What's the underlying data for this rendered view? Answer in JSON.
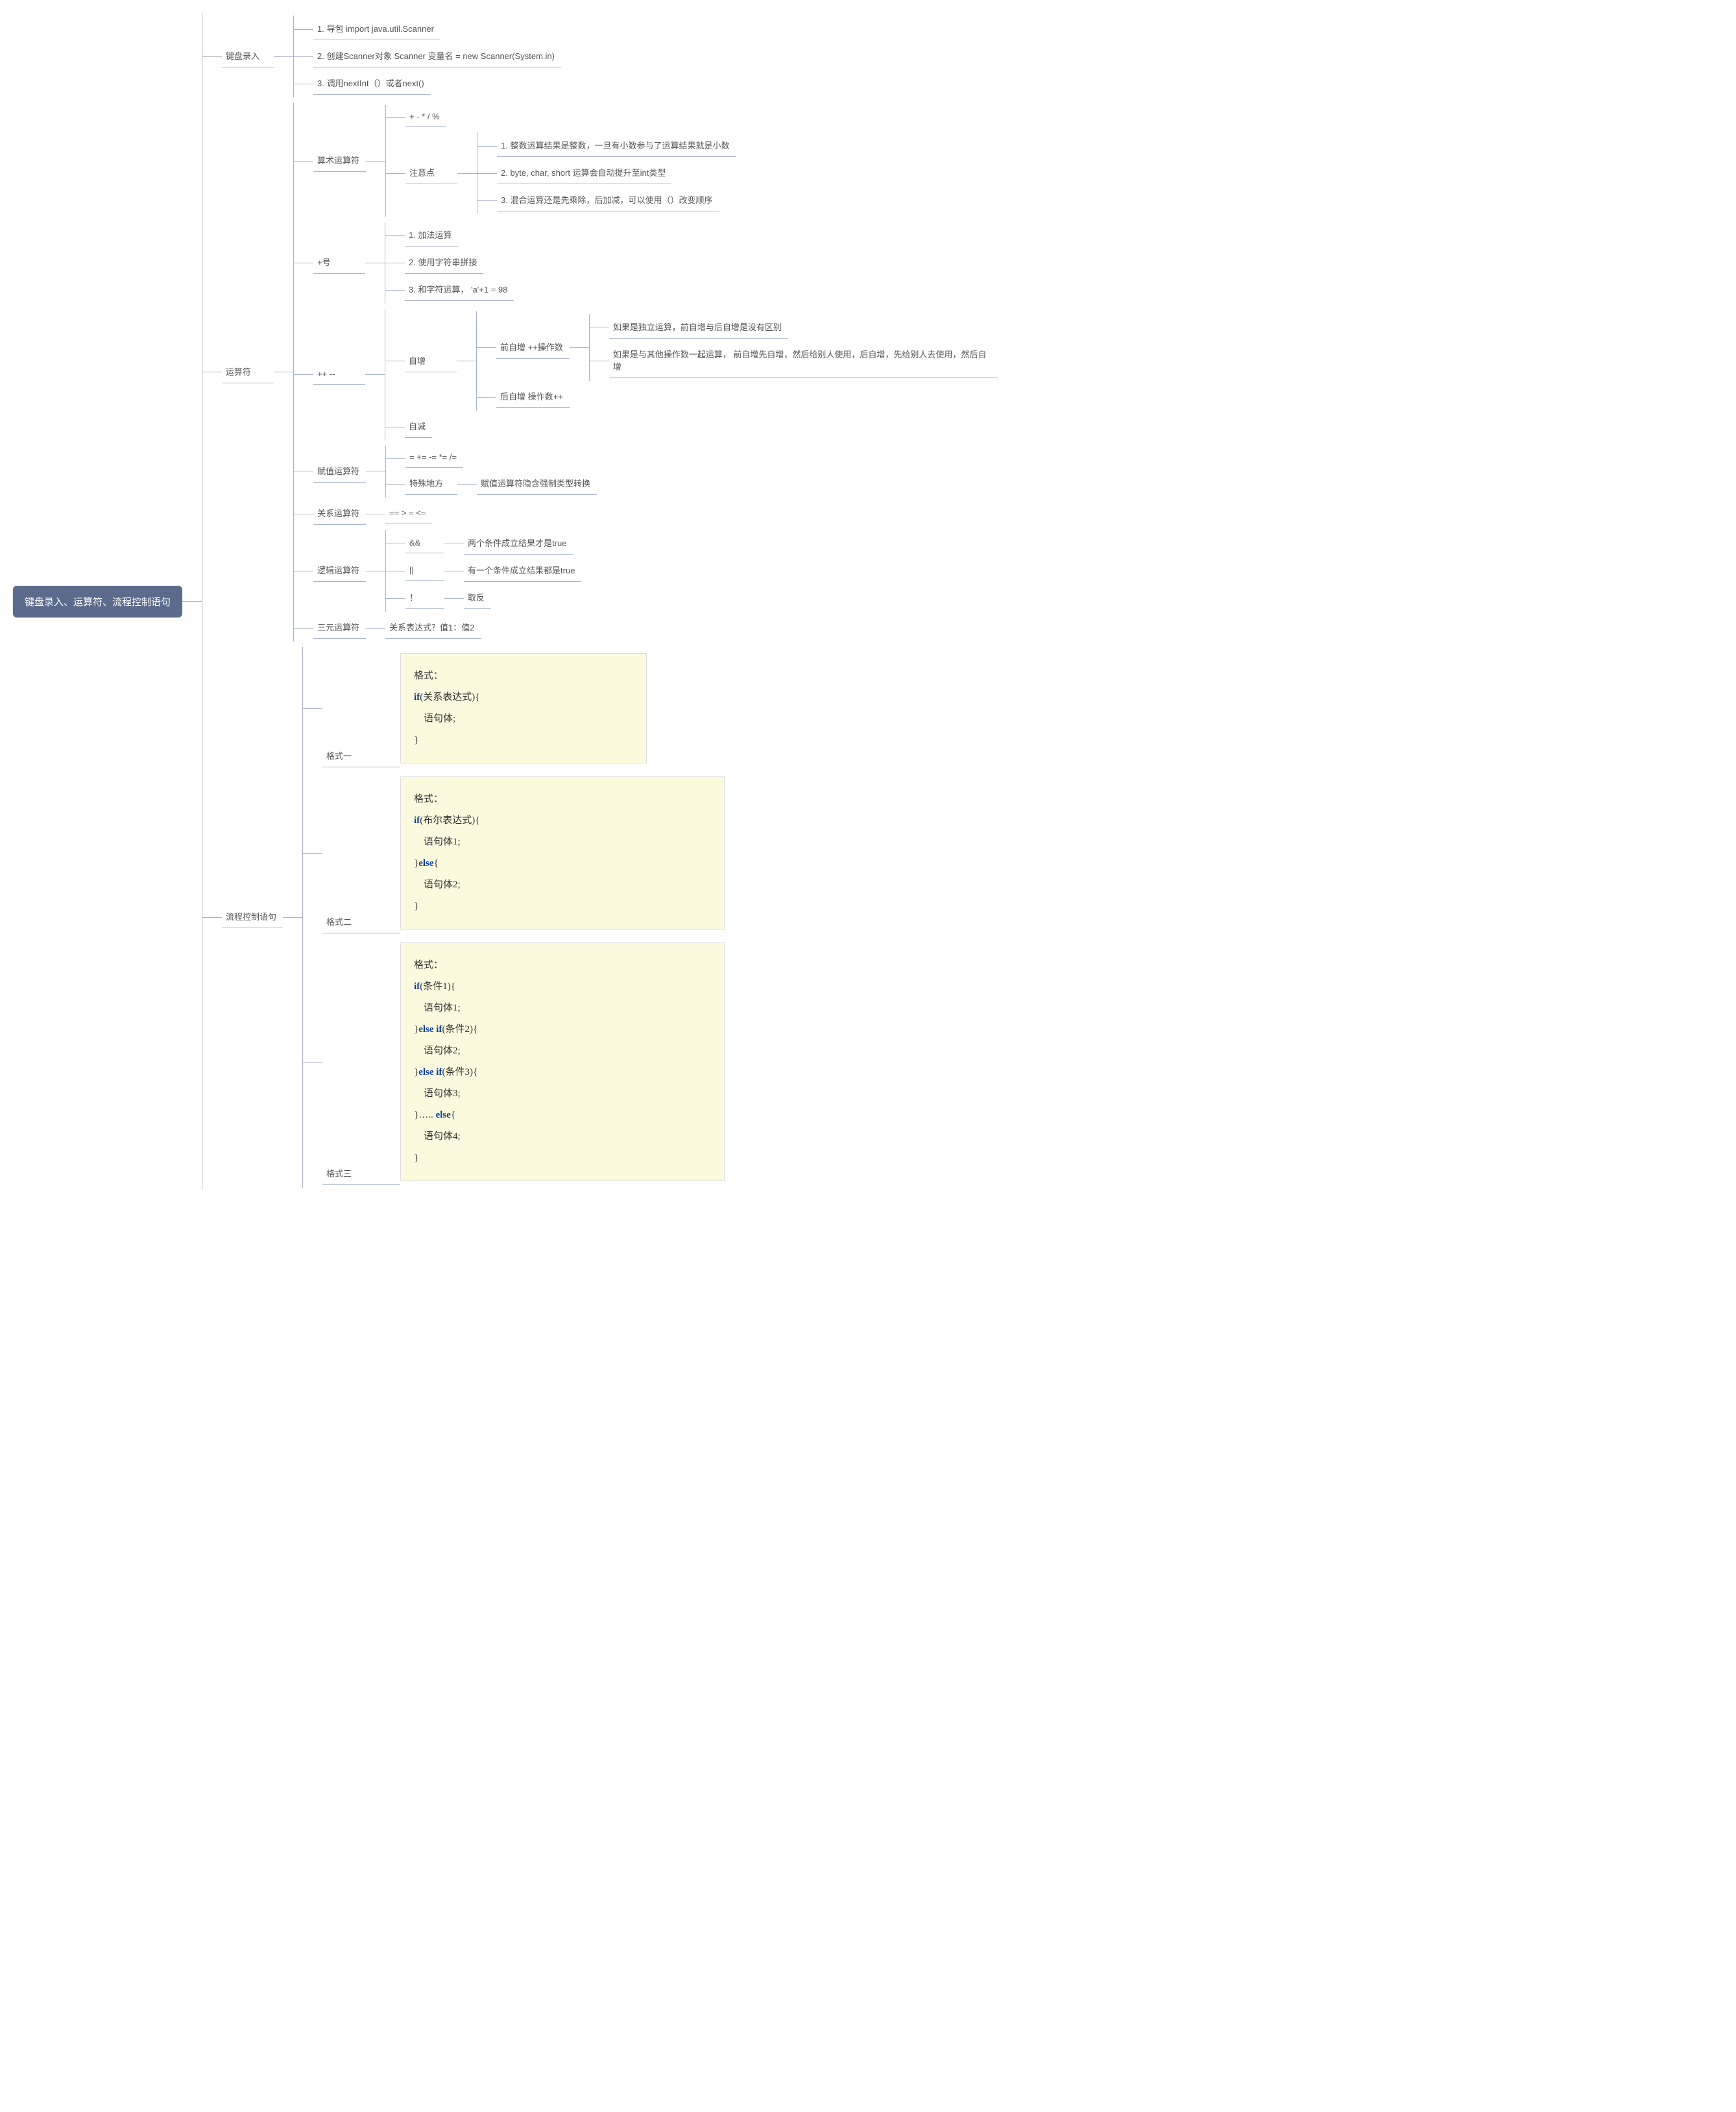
{
  "root": "键盘录入、运算符、流程控制语句",
  "keyboardInput": {
    "label": "键盘录入",
    "items": [
      "1. 导包 import java.util.Scanner",
      "2. 创建Scanner对象 Scanner 变量名 = new Scanner(System.in)",
      "3. 调用nextInt（）或者next()"
    ]
  },
  "operators": {
    "label": "运算符",
    "arithmetic": {
      "label": "算术运算符",
      "basic": "+ - * / %",
      "notes": {
        "label": "注意点",
        "items": [
          "1. 整数运算结果是整数，一旦有小数参与了运算结果就是小数",
          "2. byte, char, short 运算会自动提升至int类型",
          "3. 混合运算还是先乘除，后加减，可以使用（）改变顺序"
        ]
      }
    },
    "plus": {
      "label": "+号",
      "items": [
        "1. 加法运算",
        "2. 使用字符串拼接",
        "3. 和字符运算，  'a'+1 = 98"
      ]
    },
    "incdec": {
      "label": "++ --",
      "inc": {
        "label": "自增",
        "pre": {
          "label": "前自增 ++操作数",
          "notes": [
            "如果是独立运算，前自增与后自增是没有区别",
            "如果是与其他操作数一起运算， 前自增先自增，然后给别人使用，后自增，先给别人去使用，然后自增"
          ]
        },
        "post": "后自增 操作数++"
      },
      "dec": "自减"
    },
    "assign": {
      "label": "赋值运算符",
      "ops": "= += -= *= /=",
      "special": {
        "label": "特殊地方",
        "note": "赋值运算符隐含强制类型转换"
      }
    },
    "relation": {
      "label": "关系运算符",
      "ops": "== > = <="
    },
    "logic": {
      "label": "逻辑运算符",
      "and": {
        "op": "&&",
        "note": "两个条件成立结果才是true"
      },
      "or": {
        "op": "||",
        "note": "有一个条件成立结果都是true"
      },
      "not": {
        "op": "！",
        "note": "取反"
      }
    },
    "ternary": {
      "label": "三元运算符",
      "expr": "关系表达式？值1：值2"
    }
  },
  "flow": {
    "label": "流程控制语句",
    "fmt1": {
      "label": "格式一"
    },
    "fmt2": {
      "label": "格式二"
    },
    "fmt3": {
      "label": "格式三"
    }
  },
  "code1": {
    "l1": "格式：",
    "l2a": "if",
    "l2b": "(关系表达式){",
    "l3": "语句体;",
    "l4": "}"
  },
  "code2": {
    "l1": "格式：",
    "l2a": "if",
    "l2b": "(布尔表达式){",
    "l3": "语句体1;",
    "l4a": "}",
    "l4b": "else",
    "l4c": "{",
    "l5": "语句体2;",
    "l6": "}"
  },
  "code3": {
    "l1": "格式：",
    "l2a": "if",
    "l2b": "(条件1){",
    "l3": "语句体1;",
    "l4a": "}",
    "l4b": "else if",
    "l4c": "(条件2){",
    "l5": "语句体2;",
    "l6a": "}",
    "l6b": "else if",
    "l6c": "(条件3){",
    "l7": "语句体3;",
    "l8a": "}….. ",
    "l8b": "else",
    "l8c": "{",
    "l9": "语句体4;",
    "l10": "}"
  }
}
